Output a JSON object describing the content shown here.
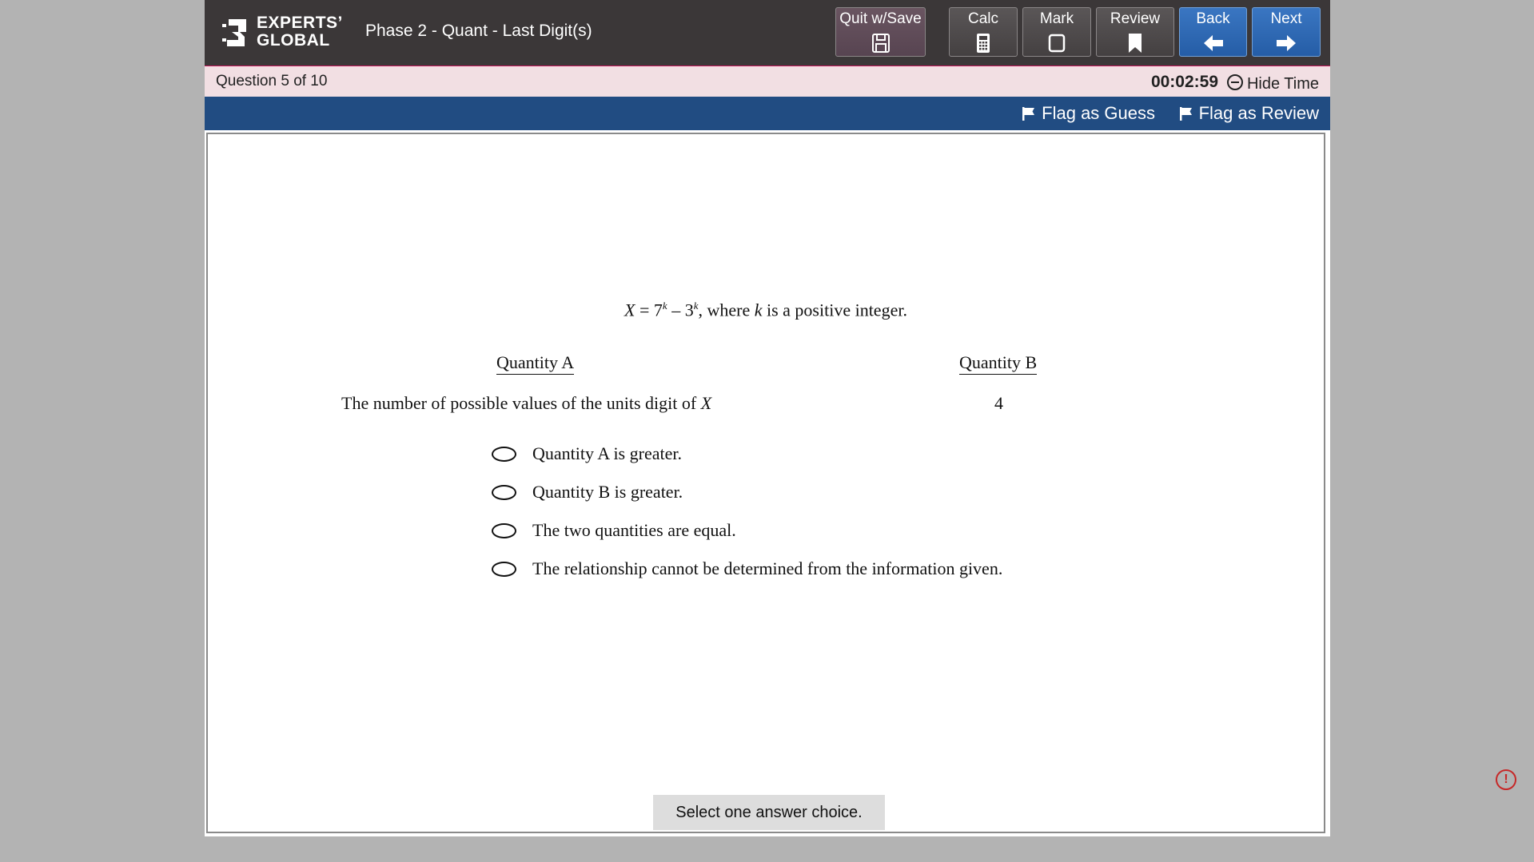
{
  "brand": {
    "line1": "EXPERTS’",
    "line2": "GLOBAL",
    "logo_icon": "experts-global-logo-icon"
  },
  "header": {
    "section_title": "Phase 2 - Quant - Last Digit(s)"
  },
  "toolbar": {
    "quit": {
      "label": "Quit w/Save",
      "icon": "floppy-disk-icon"
    },
    "calc": {
      "label": "Calc",
      "icon": "calculator-icon"
    },
    "mark": {
      "label": "Mark",
      "icon": "checkbox-icon"
    },
    "review": {
      "label": "Review",
      "icon": "bookmark-icon"
    },
    "back": {
      "label": "Back",
      "icon": "arrow-left-icon"
    },
    "next": {
      "label": "Next",
      "icon": "arrow-right-icon"
    }
  },
  "status": {
    "question_label": "Question",
    "question_number": "5",
    "question_of": "of 10",
    "timer": "00:02:59",
    "hide_time": "Hide Time"
  },
  "flags": {
    "guess": "Flag as Guess",
    "review": "Flag as Review"
  },
  "question": {
    "stem": {
      "var": "X",
      "eq": " = 7",
      "exp1": "k",
      "minus": " – 3",
      "exp2": "k",
      "mid": ", where ",
      "var2": "k",
      "tail": " is a positive integer."
    },
    "quantity_a_label": "Quantity A",
    "quantity_b_label": "Quantity B",
    "quantity_a_value": "The number of possible values of the units digit of ",
    "quantity_a_var": "X",
    "quantity_b_value": "4",
    "choices": [
      "Quantity A is greater.",
      "Quantity B is greater.",
      "The two quantities are equal.",
      "The relationship cannot be determined from the information given."
    ],
    "instruction": "Select one answer choice."
  },
  "colors": {
    "topbar": "#3b3738",
    "statusbar": "#f2dfe3",
    "flagbar": "#214c82",
    "blue_button": "#255da6",
    "alert": "#c62828"
  }
}
